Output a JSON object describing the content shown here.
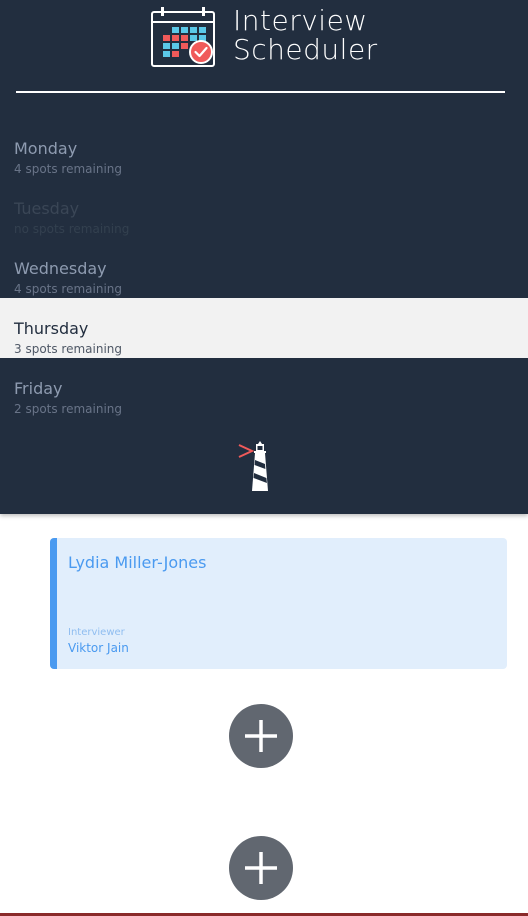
{
  "app": {
    "title_line1": "Interview",
    "title_line2": "Scheduler",
    "logo_icon": "calendar-check-icon",
    "brand_icon": "lighthouse-icon"
  },
  "days": [
    {
      "name": "Monday",
      "spots": "4 spots remaining",
      "state": "normal"
    },
    {
      "name": "Tuesday",
      "spots": "no spots remaining",
      "state": "disabled"
    },
    {
      "name": "Wednesday",
      "spots": "4 spots remaining",
      "state": "normal"
    },
    {
      "name": "Thursday",
      "spots": "3 spots remaining",
      "state": "selected"
    },
    {
      "name": "Friday",
      "spots": "2 spots remaining",
      "state": "normal"
    }
  ],
  "appointment": {
    "student": "Lydia Miller-Jones",
    "interviewer_label": "Interviewer",
    "interviewer": "Viktor Jain"
  },
  "add_buttons": [
    {
      "icon": "plus-icon"
    },
    {
      "icon": "plus-icon"
    }
  ],
  "colors": {
    "sidebar": "#222e3f",
    "selected_day": "#f2f2f2",
    "card_bg": "#e1eefc",
    "accent": "#4a9af0",
    "add_button": "#616770",
    "logo_red": "#f05a5a",
    "logo_cyan": "#5bc8e8"
  }
}
